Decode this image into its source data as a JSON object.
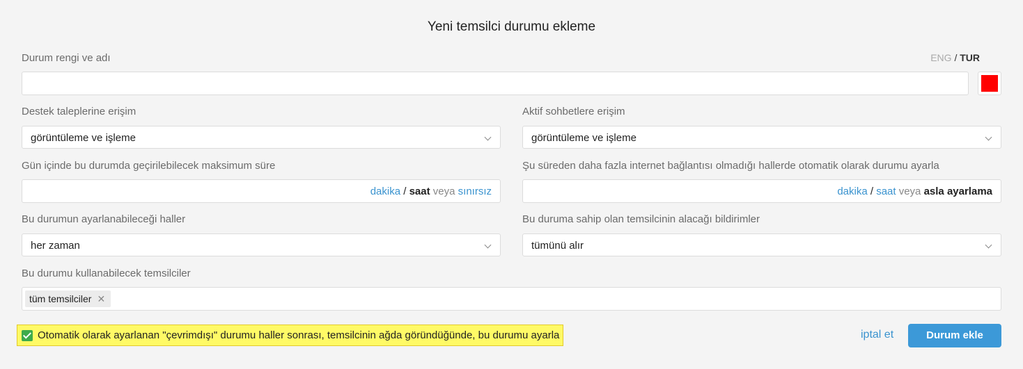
{
  "dialog": {
    "title": "Yeni temsilci durumu ekleme"
  },
  "name_field": {
    "label": "Durum rengi ve adı",
    "value": "",
    "lang_eng": "ENG",
    "lang_sep": "/",
    "lang_tur": "TUR",
    "color": "#ff0000"
  },
  "tickets_access": {
    "label": "Destek taleplerine erişim",
    "value": "görüntüleme ve işleme"
  },
  "chats_access": {
    "label": "Aktif sohbetlere erişim",
    "value": "görüntüleme ve işleme"
  },
  "max_time": {
    "label": "Gün içinde bu durumda geçirilebilecek maksimum süre",
    "value": "",
    "unit_minutes": "dakika",
    "sep": "/",
    "unit_hours": "saat",
    "or": "veya",
    "unlimited": "sınırsız"
  },
  "auto_set": {
    "label": "Şu süreden daha fazla internet bağlantısı olmadığı hallerde otomatik olarak durumu ayarla",
    "value": "",
    "unit_minutes": "dakika",
    "sep": "/",
    "unit_hours": "saat",
    "or": "veya",
    "never": "asla ayarlama"
  },
  "when_settable": {
    "label": "Bu durumun ayarlanabileceği haller",
    "value": "her zaman"
  },
  "notifications": {
    "label": "Bu duruma sahip olan temsilcinin alacağı bildirimler",
    "value": "tümünü alır"
  },
  "agents": {
    "label": "Bu durumu kullanabilecek temsilciler",
    "tags": [
      "tüm temsilciler"
    ]
  },
  "auto_checkbox": {
    "checked": true,
    "label": "Otomatik olarak ayarlanan \"çevrimdışı\" durumu haller sonrası, temsilcinin ağda göründüğünde, bu durumu ayarla"
  },
  "actions": {
    "cancel": "iptal et",
    "submit": "Durum ekle"
  }
}
